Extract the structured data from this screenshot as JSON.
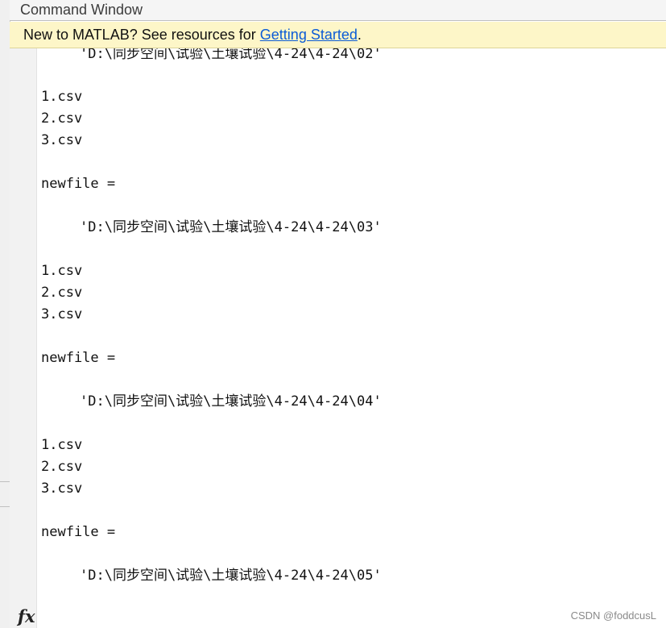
{
  "window": {
    "title": "Command Window"
  },
  "banner": {
    "text_before": "New to MATLAB? See resources for ",
    "link": "Getting Started",
    "text_after": "."
  },
  "console": {
    "lines": [
      {
        "text": "'D:\\同步空间\\试验\\土壤试验\\4-24\\4-24\\02'",
        "indent": true
      },
      {
        "text": "1.csv",
        "indent": false
      },
      {
        "text": "2.csv",
        "indent": false
      },
      {
        "text": "3.csv",
        "indent": false
      },
      {
        "text": "newfile =",
        "indent": false
      },
      {
        "text": "'D:\\同步空间\\试验\\土壤试验\\4-24\\4-24\\03'",
        "indent": true
      },
      {
        "text": "1.csv",
        "indent": false
      },
      {
        "text": "2.csv",
        "indent": false
      },
      {
        "text": "3.csv",
        "indent": false
      },
      {
        "text": "newfile =",
        "indent": false
      },
      {
        "text": "'D:\\同步空间\\试验\\土壤试验\\4-24\\4-24\\04'",
        "indent": true
      },
      {
        "text": "1.csv",
        "indent": false
      },
      {
        "text": "2.csv",
        "indent": false
      },
      {
        "text": "3.csv",
        "indent": false
      },
      {
        "text": "newfile =",
        "indent": false
      },
      {
        "text": "'D:\\同步空间\\试验\\土壤试验\\4-24\\4-24\\05'",
        "indent": true
      }
    ]
  },
  "prompt": {
    "icon": "fx-icon",
    "symbol": "fx"
  },
  "watermark": "CSDN @foddcusL"
}
